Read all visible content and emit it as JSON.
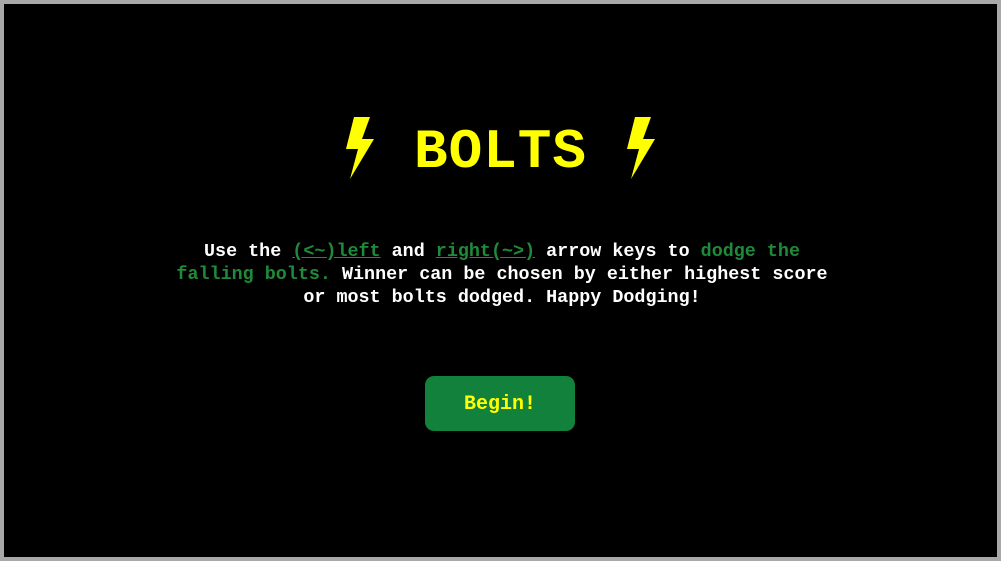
{
  "title": {
    "text": "BOLTS",
    "left_icon": "lightning-bolt-icon",
    "right_icon": "lightning-bolt-icon"
  },
  "instructions": {
    "part1": "Use the ",
    "left_key": "(<~)left",
    "part2": " and ",
    "right_key": "right(~>)",
    "part3": " arrow keys to ",
    "highlight": "dodge the falling bolts.",
    "part4": " Winner can be chosen by either highest score or most bolts dodged. Happy Dodging!"
  },
  "begin_button": {
    "label": "Begin!"
  },
  "colors": {
    "background": "#000000",
    "title": "#ffff00",
    "accent_green": "#1f8a3a",
    "button_bg": "#11813c",
    "button_text": "#ffff00",
    "text": "#ffffff"
  }
}
